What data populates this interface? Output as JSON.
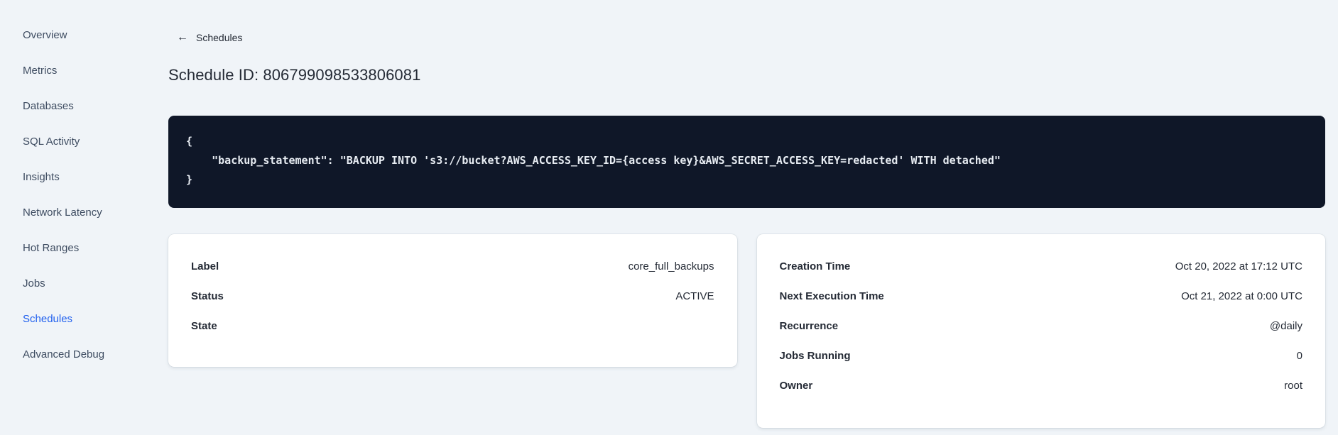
{
  "sidebar": {
    "items": [
      {
        "label": "Overview",
        "active": false
      },
      {
        "label": "Metrics",
        "active": false
      },
      {
        "label": "Databases",
        "active": false
      },
      {
        "label": "SQL Activity",
        "active": false
      },
      {
        "label": "Insights",
        "active": false
      },
      {
        "label": "Network Latency",
        "active": false
      },
      {
        "label": "Hot Ranges",
        "active": false
      },
      {
        "label": "Jobs",
        "active": false
      },
      {
        "label": "Schedules",
        "active": true
      },
      {
        "label": "Advanced Debug",
        "active": false
      }
    ]
  },
  "header": {
    "back_icon": "←",
    "back_label": "Schedules",
    "title": "Schedule ID: 806799098533806081"
  },
  "code_block": {
    "lines": [
      "{",
      "    \"backup_statement\": \"BACKUP INTO 's3://bucket?AWS_ACCESS_KEY_ID={access key}&AWS_SECRET_ACCESS_KEY=redacted' WITH detached\"",
      "}"
    ]
  },
  "details_card": {
    "rows": [
      {
        "label": "Label",
        "value": "core_full_backups"
      },
      {
        "label": "Status",
        "value": "ACTIVE"
      },
      {
        "label": "State",
        "value": ""
      }
    ]
  },
  "meta_card": {
    "rows": [
      {
        "label": "Creation Time",
        "value": "Oct 20, 2022 at 17:12 UTC"
      },
      {
        "label": "Next Execution Time",
        "value": "Oct 21, 2022 at 0:00 UTC"
      },
      {
        "label": "Recurrence",
        "value": "@daily"
      },
      {
        "label": "Jobs Running",
        "value": "0"
      },
      {
        "label": "Owner",
        "value": "root"
      }
    ]
  },
  "colors": {
    "page-bg": "#F0F4F8",
    "accent-blue": "#2261EE",
    "sidebar-text": "#3E4C61",
    "text-dark": "#242A35",
    "code-bg": "#0F1728",
    "code-text": "#E7ECF2"
  }
}
